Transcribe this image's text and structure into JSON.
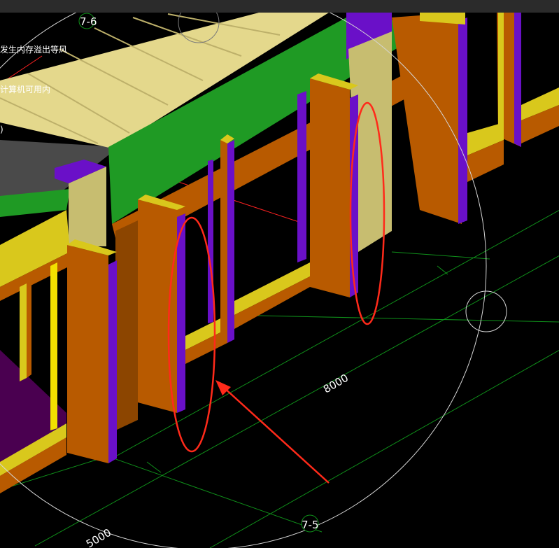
{
  "app": {
    "warning_lines": [
      "发生内存溢出等风",
      "计算机可用内",
      ")"
    ]
  },
  "viewport": {
    "axis_labels": [
      "7-6",
      "7-5"
    ],
    "dimensions": [
      "8000",
      "5000"
    ]
  },
  "colors": {
    "background": "#000000",
    "topbar": "#2b2b2b",
    "column": "#b85a00",
    "column_top": "#d9c81c",
    "beam_green": "#1f9a24",
    "slab": "#e4d88c",
    "purple": "#6a10c8",
    "wall_tan": "#c7bd70",
    "grid": "#0f8f1a",
    "annotation_red": "#ff2a1a",
    "circle": "#d6d6d6"
  }
}
